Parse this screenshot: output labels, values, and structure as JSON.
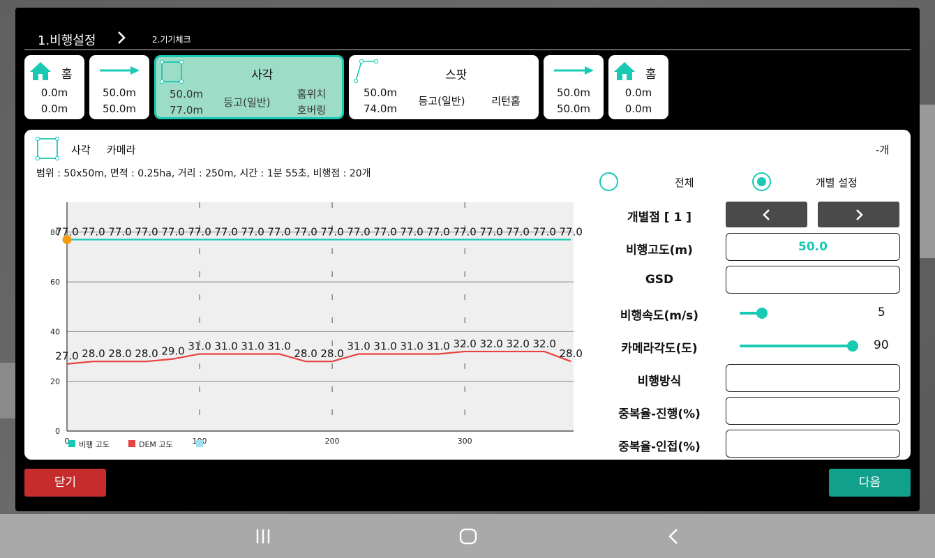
{
  "steps": {
    "step1": "1.비행설정",
    "step2": "2.기기체크"
  },
  "waypoints": [
    {
      "title": "홈",
      "line1": "0.0m",
      "line2": "0.0m"
    },
    {
      "title": "",
      "line1": "50.0m",
      "line2": "50.0m"
    },
    {
      "title": "사각",
      "line1": "50.0m",
      "line2": "77.0m",
      "mid": "등고(일반)",
      "right1": "홈위치",
      "right2": "호버링"
    },
    {
      "title": "스팟",
      "line1": "50.0m",
      "line2": "74.0m",
      "mid": "등고(일반)",
      "right1": "리턴홈"
    },
    {
      "title": "",
      "line1": "50.0m",
      "line2": "50.0m"
    },
    {
      "title": "홈",
      "line1": "0.0m",
      "line2": "0.0m"
    }
  ],
  "panel": {
    "type": "사각",
    "camera": "카메라",
    "count": "-개",
    "summary": "범위 : 50x50m, 면적 : 0.25ha, 거리 : 250m, 시간 : 1분 55초, 비행점 : 20개"
  },
  "settings": {
    "radio_all": "전체",
    "radio_individual": "개별 설정",
    "point_label": "개별점 [ 1 ]",
    "altitude_label": "비행고도(m)",
    "altitude_value": "50.0",
    "gsd_label": "GSD",
    "gsd_value": "",
    "speed_label": "비행속도(m/s)",
    "speed_value": "5",
    "speed_fraction": 0.2,
    "cam_angle_label": "카메라각도(도)",
    "cam_angle_value": "90",
    "cam_angle_fraction": 1.0,
    "method_label": "비행방식",
    "method_value": "",
    "overlap_fwd_label": "중복율-진행(%)",
    "overlap_fwd_value": "",
    "overlap_side_label": "중복율-인접(%)",
    "overlap_side_value": ""
  },
  "buttons": {
    "close": "닫기",
    "next": "다음"
  },
  "chart_data": {
    "type": "line",
    "x": [
      0,
      20,
      40,
      60,
      80,
      100,
      120,
      140,
      160,
      180,
      200,
      220,
      240,
      260,
      280,
      300,
      320,
      340,
      360,
      380
    ],
    "xlim": [
      0,
      382
    ],
    "ylim": [
      0,
      92
    ],
    "x_ticks": [
      0,
      100,
      200,
      300
    ],
    "y_ticks": [
      0,
      20,
      40,
      60,
      80
    ],
    "grid": true,
    "legend": "bottom-left",
    "series": [
      {
        "name": "비행 고도",
        "color": "#18c9b3",
        "values": [
          77,
          77,
          77,
          77,
          77,
          77,
          77,
          77,
          77,
          77,
          77,
          77,
          77,
          77,
          77,
          77,
          77,
          77,
          77,
          77
        ],
        "labels": [
          "77.0",
          "77.0",
          "77.0",
          "77.0",
          "77.0",
          "77.0",
          "77.0",
          "77.0",
          "77.0",
          "77.0",
          "77.0",
          "77.0",
          "77.0",
          "77.0",
          "77.0",
          "77.0",
          "77.0",
          "77.0",
          "77.0",
          "77.0"
        ]
      },
      {
        "name": "DEM 고도",
        "color": "#e94040",
        "values": [
          27,
          28,
          28,
          28,
          29,
          31,
          31,
          31,
          31,
          28,
          28,
          31,
          31,
          31,
          31,
          32,
          32,
          32,
          32,
          28
        ],
        "labels": [
          "27.0",
          "28.0",
          "28.0",
          "28.0",
          "29.0",
          "31.0",
          "31.0",
          "31.0",
          "31.0",
          "28.0",
          "28.0",
          "31.0",
          "31.0",
          "31.0",
          "31.0",
          "32.0",
          "32.0",
          "32.0",
          "32.0",
          "28.0"
        ]
      },
      {
        "name": "",
        "color": "#9fe2ee",
        "values": []
      }
    ]
  }
}
